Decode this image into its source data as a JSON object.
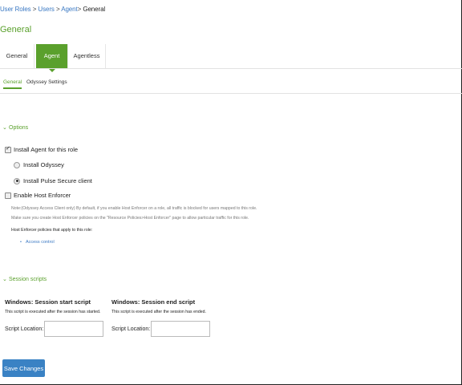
{
  "breadcrumb": {
    "items": [
      "User Roles",
      "Users",
      "Agent"
    ],
    "separator": ">",
    "current": "General"
  },
  "page_title": "General",
  "tabs": [
    {
      "label": "General",
      "active": false
    },
    {
      "label": "Agent",
      "active": true
    },
    {
      "label": "Agentless",
      "active": false
    }
  ],
  "subtabs": [
    {
      "label": "General",
      "active": true
    },
    {
      "label": "Odyssey Settings",
      "active": false
    }
  ],
  "options": {
    "header": "Options",
    "install_agent": {
      "label": "Install Agent for this role",
      "checked": true
    },
    "install_odyssey": {
      "label": "Install Odyssey",
      "checked": false
    },
    "install_pulse": {
      "label": "Install Pulse Secure client",
      "checked": true
    },
    "enable_host_enforcer": {
      "label": "Enable Host Enforcer",
      "checked": false
    },
    "note1": "Note:(Odyssey Access Client only) By default, if you enable Host Enforcer on a role, all traffic is blocked for users mapped to this role.",
    "note2": "Make sure you create Host Enforcer policies on the \"Resource Policies>Host Enforcer\" page to allow particular traffic for this role.",
    "policies_label": "Host Enforcer policies that apply to this role:",
    "policies": [
      "Access control"
    ]
  },
  "session_scripts": {
    "header": "Session scripts",
    "start": {
      "title": "Windows: Session start script",
      "description": "This script is executed after the session has started.",
      "location_label": "Script Location:",
      "location_value": ""
    },
    "end": {
      "title": "Windows: Session end script",
      "description": "This script is executed after the session has ended.",
      "location_label": "Script Location:",
      "location_value": ""
    }
  },
  "save_label": "Save Changes",
  "colors": {
    "accent_green": "#5aa02c",
    "link_blue": "#3a78c3",
    "button_blue": "#3a82c4"
  }
}
